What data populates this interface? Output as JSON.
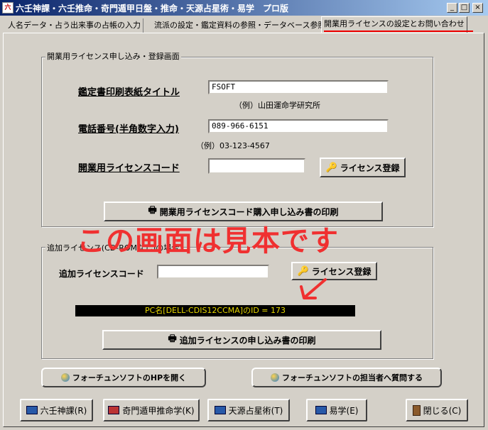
{
  "window": {
    "title": "六壬神課・六壬推命・奇門遁甲日盤・推命・天源占星術・易学　プロ版",
    "app_icon_glyph": "六",
    "minimize": "_",
    "maximize": "□",
    "close": "×"
  },
  "tabs": [
    {
      "label": "人名データ・占う出来事の占帳の入力"
    },
    {
      "label": "流派の設定・鑑定資料の参照・データベース参照"
    },
    {
      "label": "開業用ライセンスの設定とお問い合わせ",
      "active": true
    }
  ],
  "license_group": {
    "legend": "開業用ライセンス申し込み・登録画面",
    "title_label": "鑑定書印刷表紙タイトル",
    "title_value": "FSOFT",
    "title_hint": "（例）山田運命学研究所",
    "phone_label": "電話番号(半角数字入力)",
    "phone_value": "089-966-6151",
    "phone_hint": "（例）03-123-4567",
    "code_label": "開業用ライセンスコード",
    "code_value": "",
    "register_button": "ライセンス登録",
    "print_button": "開業用ライセンスコード購入申し込み書の印刷"
  },
  "additional_group": {
    "legend": "追加ライセンス(CD-ROMなし)の場合",
    "code_label": "追加ライセンスコード",
    "code_value": "",
    "register_button": "ライセンス登録",
    "pc_id_text": "PC名[DELL-CDIS12CCMA]のID = 173",
    "print_button": "追加ライセンスの申し込み書の印刷"
  },
  "watermark": "この画面は見本です",
  "links": {
    "open_hp": "フォーチュンソフトのHPを開く",
    "ask_staff": "フォーチュンソフトの担当者へ質問する"
  },
  "nav": {
    "rikujin": "六壬神課(R)",
    "kimon": "奇門遁甲推命学(K)",
    "tengen": "天源占星術(T)",
    "ekigaku": "易学(E)",
    "close": "閉じる(C)"
  },
  "colors": {
    "watermark": "#f03030",
    "pc_id_text": "#e8d800",
    "tab_highlight": "#e00000"
  }
}
